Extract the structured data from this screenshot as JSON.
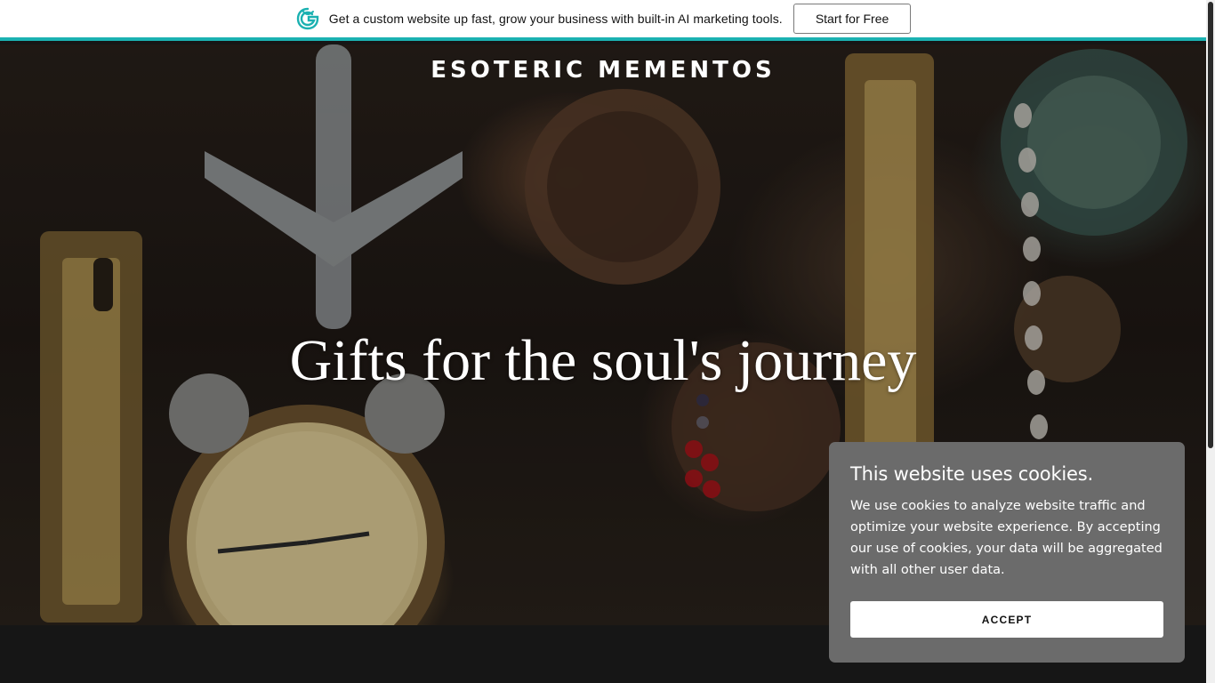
{
  "promo": {
    "text": "Get a custom website up fast, grow your business with built-in AI marketing tools.",
    "button_label": "Start for Free",
    "accent_color": "#1bb1b1",
    "logo_icon": "godaddy-logo-icon"
  },
  "site": {
    "title": "ESOTERIC MEMENTOS"
  },
  "hero": {
    "heading": "Gifts for the soul's journey"
  },
  "cookie": {
    "title": "This website uses cookies.",
    "body": "We use cookies to analyze website traffic and optimize your website experience. By accepting our use of cookies, your data will be aggregated with all other user data.",
    "accept_label": "ACCEPT",
    "background_color": "#6b6b6b"
  }
}
